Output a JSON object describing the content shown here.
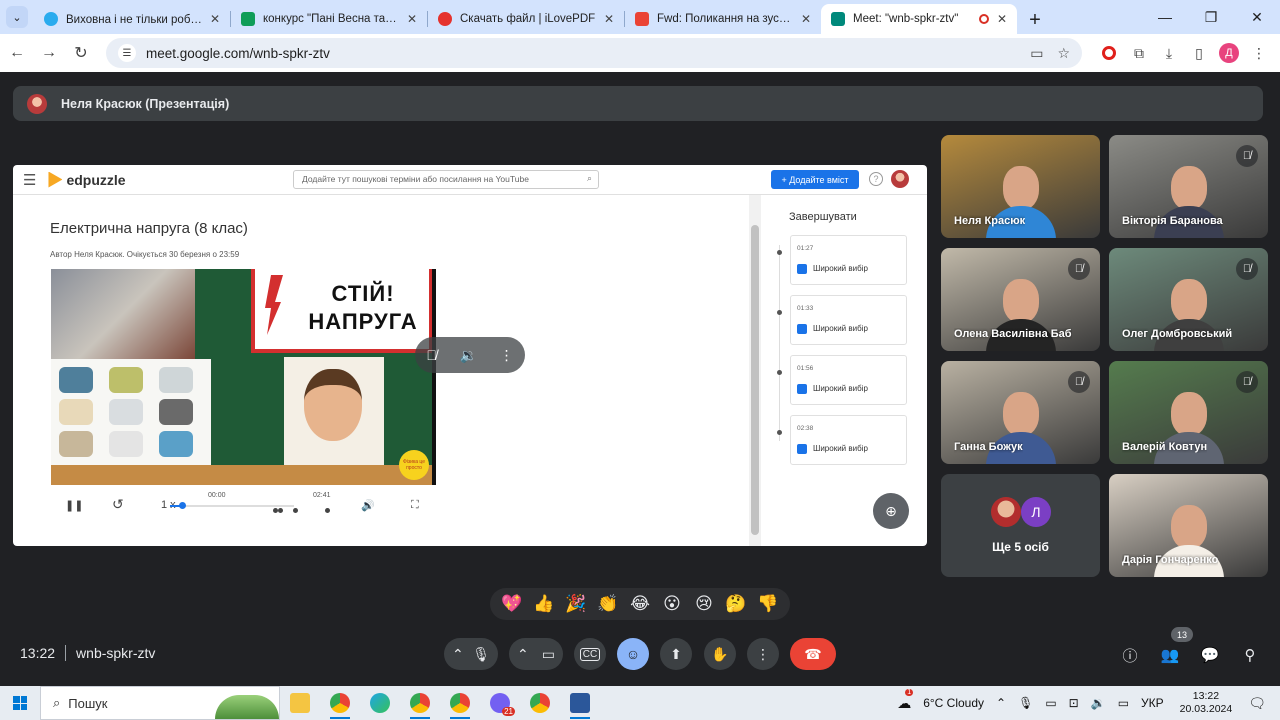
{
  "browser": {
    "tabs": [
      {
        "title": "Виховна і не тільки робота 👩‍🏫",
        "color": "#2aabee"
      },
      {
        "title": "конкурс \"Пані Весна та Пан Бе",
        "color": "#0f9d58"
      },
      {
        "title": "Скачать файл | iLovePDF",
        "color": "#e5322d"
      },
      {
        "title": "Fwd: Поликання на зустріч - (",
        "color": "#ea4335"
      },
      {
        "title": "Meet: \"wnb-spkr-ztv\"",
        "color": "#00897b"
      }
    ],
    "url": "meet.google.com/wnb-spkr-ztv",
    "profile_letter": "Д"
  },
  "presenter": {
    "label": "Неля Красюк (Презентація)"
  },
  "edpuzzle": {
    "logo": "edpuzzle",
    "search_placeholder": "Додайте тут пошукові терміни або посилання на YouTube",
    "add_button": "+ Додайте вміст",
    "lesson_title": "Електрична напруга (8 клас)",
    "lesson_meta": "Автор Неля Красюк. Очікується 30 березня о 23:59",
    "video_sign_line1": "СТІЙ!",
    "video_sign_line2": "НАПРУГА",
    "video_badge": "Фізика це просто",
    "speed": "1 x",
    "time_start": "00:00",
    "time_end": "02:41",
    "progress_fraction": 0.1,
    "questions_title": "Завершувати",
    "questions": [
      {
        "time": "01:27",
        "label": "Широкий вибір"
      },
      {
        "time": "01:33",
        "label": "Широкий вибір"
      },
      {
        "time": "01:56",
        "label": "Широкий вибір"
      },
      {
        "time": "02:38",
        "label": "Широкий вибір"
      }
    ]
  },
  "participants": [
    {
      "name": "Неля Красюк",
      "muted": false,
      "bg": "#b58a3c",
      "shirt": "#2f86d6"
    },
    {
      "name": "Вікторія Баранова",
      "muted": true,
      "bg": "#8b8b86",
      "shirt": "#3b3f52"
    },
    {
      "name": "Олена Василівна Баб",
      "muted": true,
      "bg": "#c1b9a9",
      "shirt": "#242424"
    },
    {
      "name": "Олег Домбровський",
      "muted": true,
      "bg": "#6d8a7b",
      "shirt": "#3f3f3f"
    },
    {
      "name": "Ганна Божук",
      "muted": true,
      "bg": "#b9b1a2",
      "shirt": "#3f5a93"
    },
    {
      "name": "Валерій Ковтун",
      "muted": true,
      "bg": "#557c4e",
      "shirt": "#5f6572"
    },
    {
      "name": "Дарія Гончаренко",
      "muted": false,
      "bg": "#d8cfc3",
      "shirt": "#f4efe7"
    }
  ],
  "more": {
    "label": "Ще 5 осіб",
    "avatar_letter": "Л"
  },
  "reactions": [
    "💖",
    "👍",
    "🎉",
    "👏",
    "😂",
    "😮",
    "😢",
    "🤔",
    "👎"
  ],
  "meeting": {
    "time": "13:22",
    "code": "wnb-spkr-ztv",
    "people_count": "13"
  },
  "taskbar": {
    "search_label": "Пошук",
    "weather": "6°C  Cloudy",
    "language": "УКР",
    "clock_time": "13:22",
    "clock_date": "20.03.2024",
    "notif_count": "1",
    "viber_count": "21"
  }
}
